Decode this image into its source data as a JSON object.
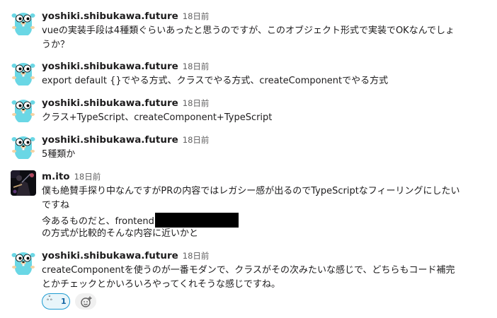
{
  "messages": [
    {
      "author": "yoshiki.shibukawa.future",
      "time": "18日前",
      "avatar": "gopher-avatar",
      "lines": [
        "vueの実装手段は4種類ぐらいあったと思うのですが、このオブジェクト形式で実装でOKなんでしょ",
        "うか？"
      ]
    },
    {
      "author": "yoshiki.shibukawa.future",
      "time": "18日前",
      "avatar": "gopher-avatar",
      "lines": [
        "export default {}でやる方式、クラスでやる方式、createComponentでやる方式"
      ]
    },
    {
      "author": "yoshiki.shibukawa.future",
      "time": "18日前",
      "avatar": "gopher-avatar",
      "lines": [
        "クラス+TypeScript、createComponent+TypeScript"
      ]
    },
    {
      "author": "yoshiki.shibukawa.future",
      "time": "18日前",
      "avatar": "gopher-avatar",
      "lines": [
        "5種類か"
      ]
    },
    {
      "author": "m.ito",
      "time": "18日前",
      "avatar": "photo-avatar",
      "lines": [
        "僕も絶賛手探り中なんですがPRの内容ではレガシー感が出るのでTypeScriptなフィーリングにしたい",
        "ですね",
        "今あるものだと、frontend",
        "の方式が比較的そんな内容に近いかと"
      ]
    },
    {
      "author": "yoshiki.shibukawa.future",
      "time": "18日前",
      "avatar": "gopher-avatar",
      "lines": [
        "createComponentを使うのが一番モダンで、クラスがその次みたいな感じで、どちらもコード補完",
        "とかチェックとかいろいろやってくれそうな感じですね。"
      ]
    }
  ],
  "reactions": {
    "emoji_icon": "thinking-gopher-emoji",
    "emoji_glyph": "ஃ",
    "count": "1",
    "add_icon": "add-reaction-icon"
  },
  "colors": {
    "gopher": "#6ad7e5",
    "reaction_border": "#1d9bd1",
    "reaction_bg": "#e8f5fa",
    "text": "#1d1c1d",
    "muted": "#616061"
  }
}
